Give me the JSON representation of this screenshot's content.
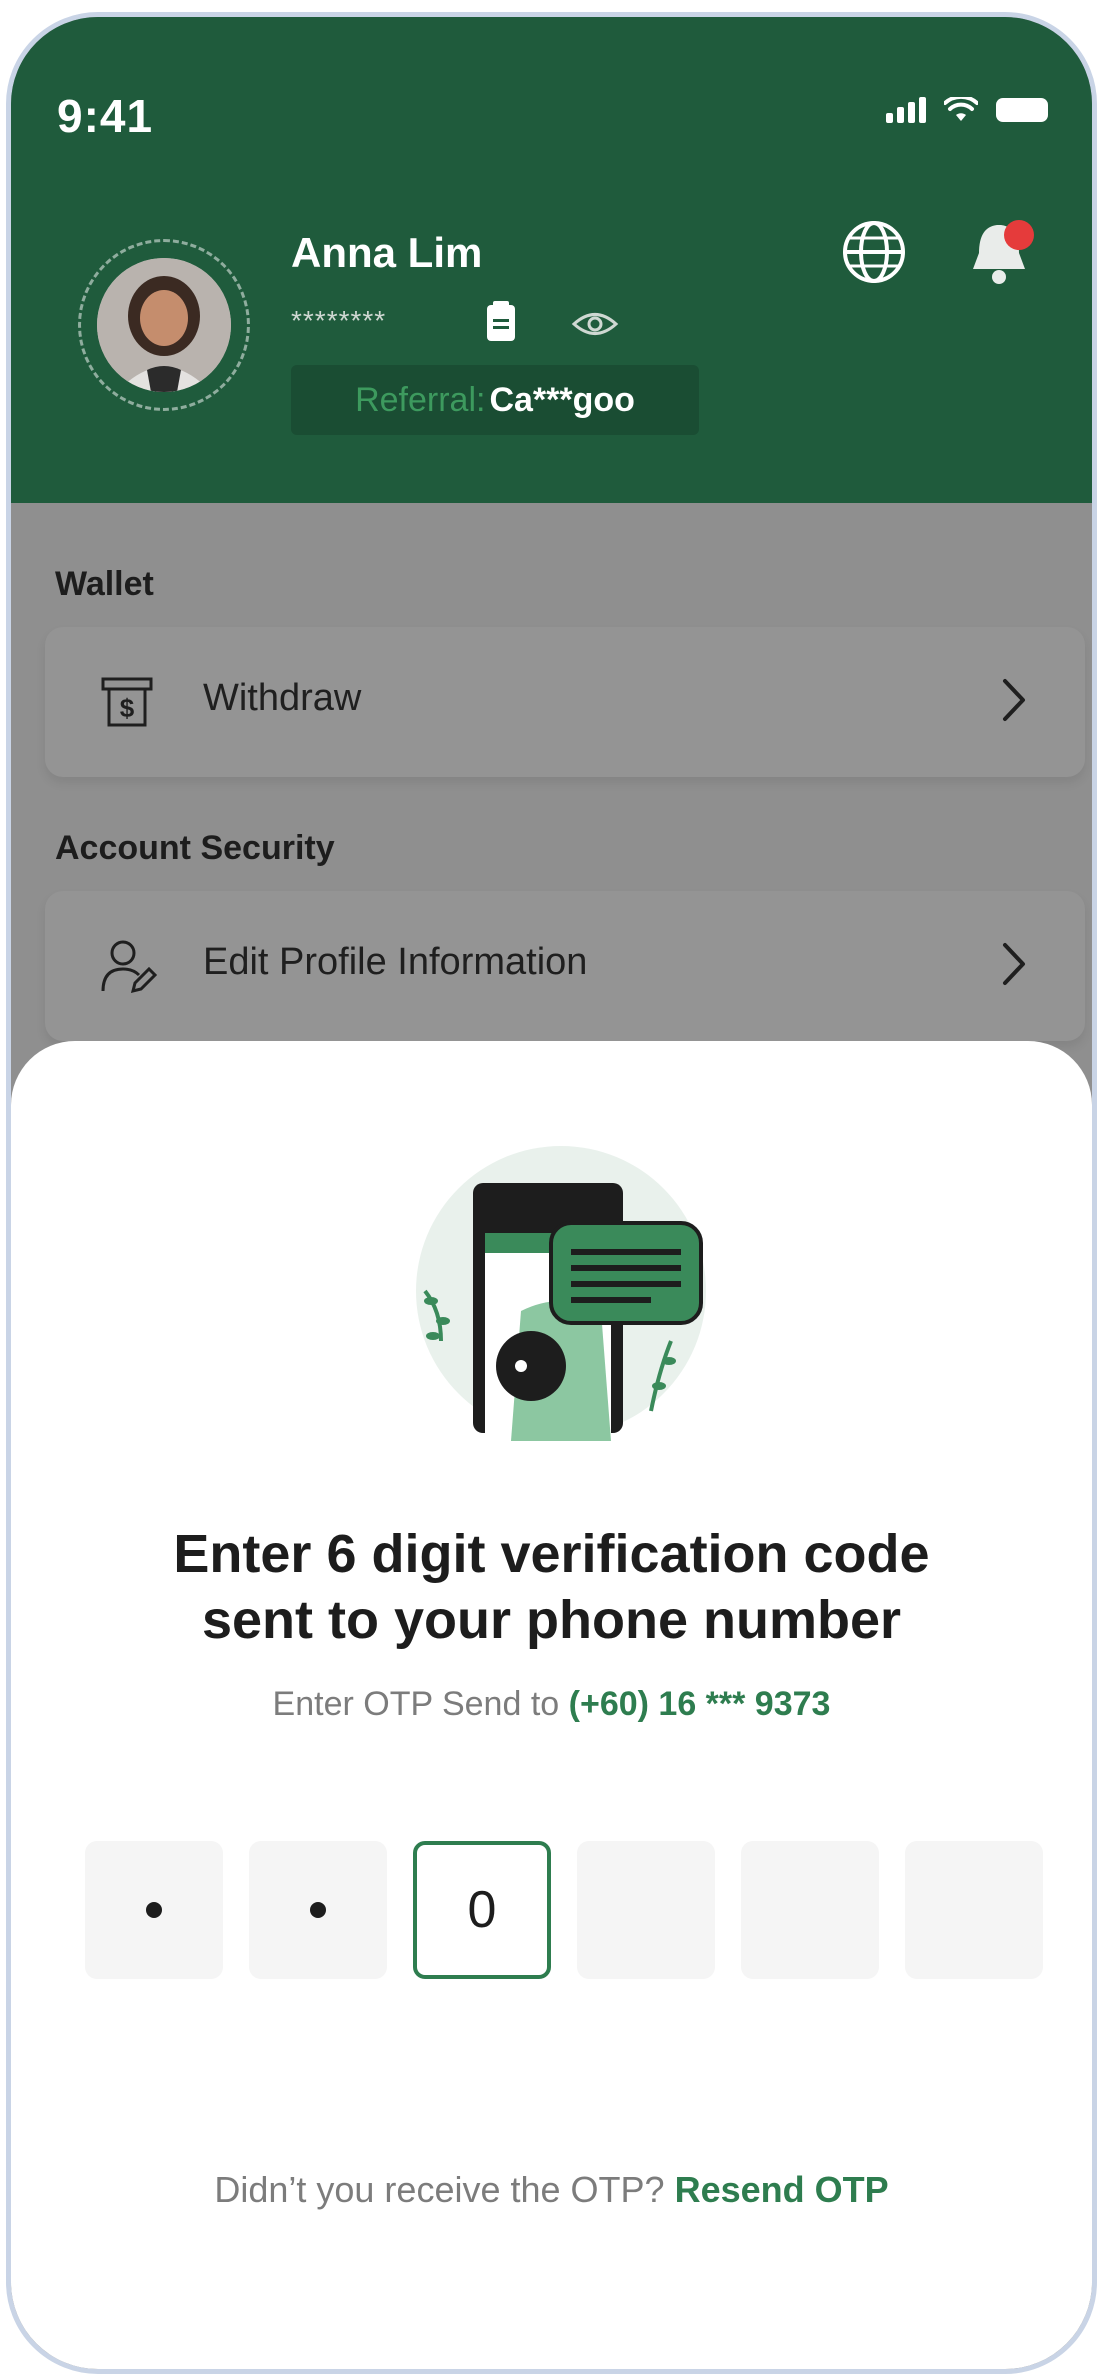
{
  "status_bar": {
    "time": "9:41"
  },
  "profile": {
    "name": "Anna Lim",
    "masked_id": "********",
    "referral_label": "Referral:",
    "referral_code": "Ca***goo"
  },
  "sections": {
    "wallet": {
      "title": "Wallet",
      "items": [
        {
          "label": "Withdraw",
          "icon": "atm-cash-icon"
        }
      ]
    },
    "account_security": {
      "title": "Account Security",
      "items": [
        {
          "label": "Edit Profile Information",
          "icon": "edit-user-icon"
        }
      ]
    }
  },
  "otp_sheet": {
    "title_line1": "Enter 6 digit verification code",
    "title_line2": "sent to your phone number",
    "subtitle_prefix": "Enter OTP Send to",
    "phone": "(+60) 16 *** 9373",
    "digits": [
      "•",
      "•",
      "0",
      "",
      "",
      ""
    ],
    "active_index": 2,
    "resend_prompt": "Didn’t you receive the OTP?",
    "resend_link": "Resend OTP"
  },
  "colors": {
    "brand_green": "#1f5b3c",
    "accent_green": "#2e7d4f",
    "overlay_gray": "#8f8f8f"
  }
}
